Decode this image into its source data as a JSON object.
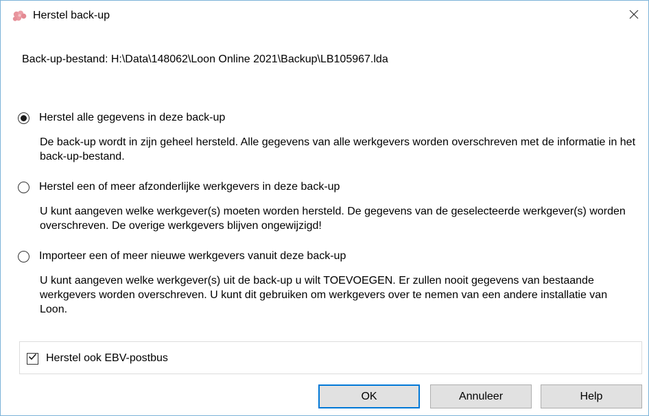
{
  "window": {
    "title": "Herstel back-up",
    "app_icon": "pink-flower-icon",
    "close_icon": "close-icon"
  },
  "backup_file": "Back-up-bestand: H:\\Data\\148062\\Loon Online 2021\\Backup\\LB105967.lda",
  "options": [
    {
      "label": "Herstel alle gegevens in deze back-up",
      "selected": true,
      "description": "De back-up wordt in zijn geheel hersteld. Alle gegevens van alle werkgevers worden overschreven met de informatie in het back-up-bestand."
    },
    {
      "label": "Herstel een of meer afzonderlijke werkgevers in deze back-up",
      "selected": false,
      "description": "U kunt aangeven welke werkgever(s) moeten worden hersteld. De gegevens van de geselecteerde werkgever(s) worden overschreven. De overige werkgevers blijven ongewijzigd!"
    },
    {
      "label": "Importeer een of meer nieuwe werkgevers vanuit deze back-up",
      "selected": false,
      "description": "U kunt aangeven welke werkgever(s) uit de back-up u wilt TOEVOEGEN. Er zullen nooit gegevens van bestaande werkgevers worden overschreven. U kunt dit gebruiken om werkgevers over te nemen van een andere installatie van Loon."
    }
  ],
  "ebv_checkbox": {
    "label": "Herstel ook EBV-postbus",
    "checked": true
  },
  "buttons": {
    "ok": "OK",
    "cancel": "Annuleer",
    "help": "Help"
  },
  "colors": {
    "accent": "#0078d7",
    "button_face": "#e1e1e1",
    "window_border": "#7ab2d8",
    "icon_pink": "#e8959d"
  }
}
